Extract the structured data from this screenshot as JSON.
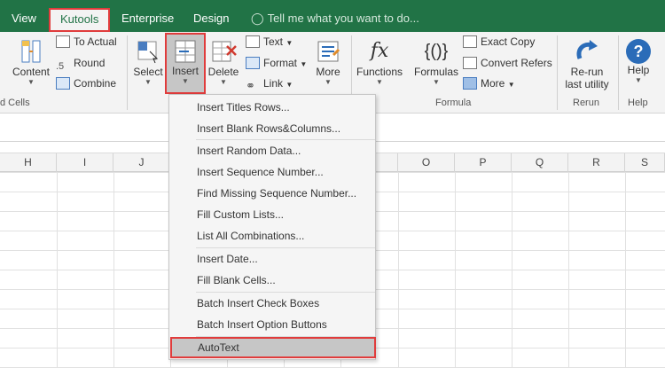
{
  "tabs": [
    {
      "label": "View"
    },
    {
      "label": "Kutools"
    },
    {
      "label": "Enterprise"
    },
    {
      "label": "Design"
    }
  ],
  "tell_me": "Tell me what you want to do...",
  "ribbon": {
    "content": "Content",
    "to_actual": "To Actual",
    "round": "Round",
    "combine": "Combine",
    "group_cells": "d Cells",
    "select": "Select",
    "insert": "Insert",
    "delete": "Delete",
    "text": "Text",
    "format": "Format",
    "link": "Link",
    "more": "More",
    "functions": "Functions",
    "formulas": "Formulas",
    "exact_copy": "Exact Copy",
    "convert_refers": "Convert Refers",
    "more2": "More",
    "group_formula": "Formula",
    "rerun_line1": "Re-run",
    "rerun_line2": "last utility",
    "group_rerun": "Rerun",
    "help": "Help",
    "group_help": "Help"
  },
  "columns": [
    "H",
    "I",
    "J",
    "O",
    "P",
    "Q",
    "R",
    "S"
  ],
  "menu": {
    "items": [
      "Insert Titles Rows...",
      "Insert Blank Rows&Columns...",
      "Insert Random Data...",
      "Insert Sequence Number...",
      "Find Missing Sequence Number...",
      "Fill Custom Lists...",
      "List All Combinations...",
      "Insert Date...",
      "Fill Blank Cells...",
      "Batch Insert Check Boxes",
      "Batch Insert Option Buttons",
      "AutoText"
    ]
  },
  "colors": {
    "tabbar": "#217346",
    "highlight_border": "#e03c3c",
    "accent_blue": "#2b6cb8"
  }
}
